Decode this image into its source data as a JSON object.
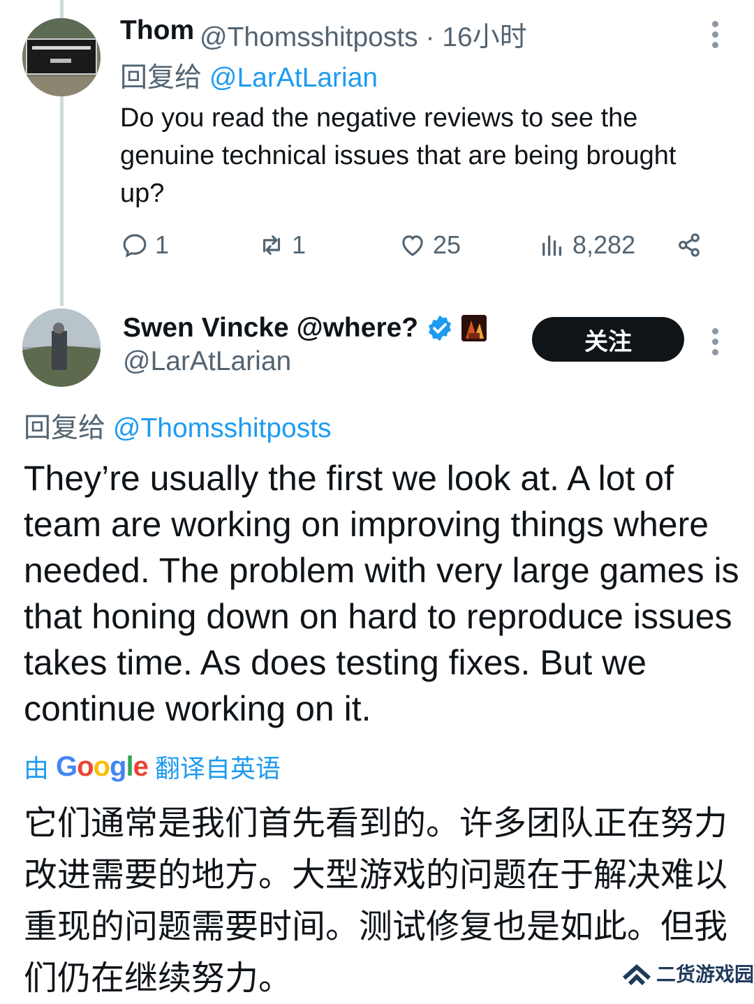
{
  "tweet1": {
    "name": "Thom",
    "handle_time": "@Thomsshitposts · 16小时",
    "reply_prefix": "回复给",
    "reply_to": "@LarAtLarian",
    "text": "Do you read the negative reviews to see the genuine technical issues that are being brought up?",
    "replies": "1",
    "retweets": "1",
    "likes": "25",
    "views": "8,282"
  },
  "tweet2": {
    "name": "Swen Vincke @where?",
    "handle": "@LarAtLarian",
    "follow_label": "关注",
    "reply_prefix": "回复给",
    "reply_to": "@Thomsshitposts",
    "text": "They’re usually the first we look at. A lot of team are working on improving things where needed. The problem with very large games is that honing down on hard to reproduce issues takes time. As does testing fixes. But we continue working on it.",
    "translate_prefix": "由",
    "translate_brand": "Google",
    "translate_suffix": "翻译自英语",
    "translation": "它们通常是我们首先看到的。许多团队正在努力改进需要的地方。大型游戏的问题在于解决难以重现的问题需要时间。测试修复也是如此。但我们仍在继续努力。"
  },
  "watermark": {
    "text": "二货游戏园"
  },
  "colors": {
    "accent": "#1d9bf0",
    "muted": "#536471",
    "text": "#0f1419"
  }
}
